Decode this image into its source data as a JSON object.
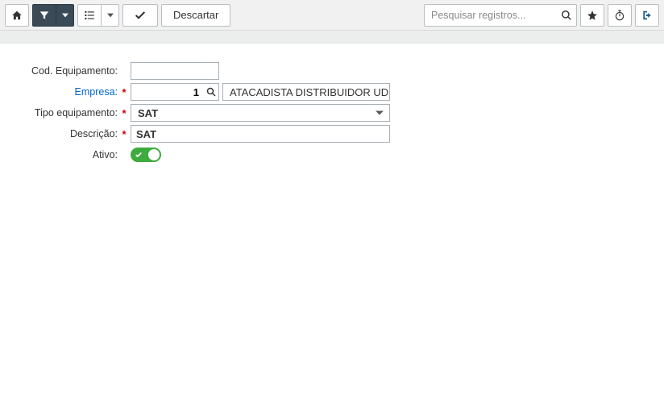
{
  "toolbar": {
    "search_placeholder": "Pesquisar registros...",
    "discard_label": "Descartar"
  },
  "form": {
    "labels": {
      "cod_equipamento": "Cod. Equipamento:",
      "empresa": "Empresa:",
      "tipo_equipamento": "Tipo equipamento:",
      "descricao": "Descrição:",
      "ativo": "Ativo:"
    },
    "values": {
      "cod_equipamento": "",
      "empresa_id": "1",
      "empresa_nome": "ATACADISTA DISTRIBUIDOR UD",
      "tipo_equipamento_selected": "SAT",
      "descricao": "SAT",
      "ativo": true
    }
  }
}
